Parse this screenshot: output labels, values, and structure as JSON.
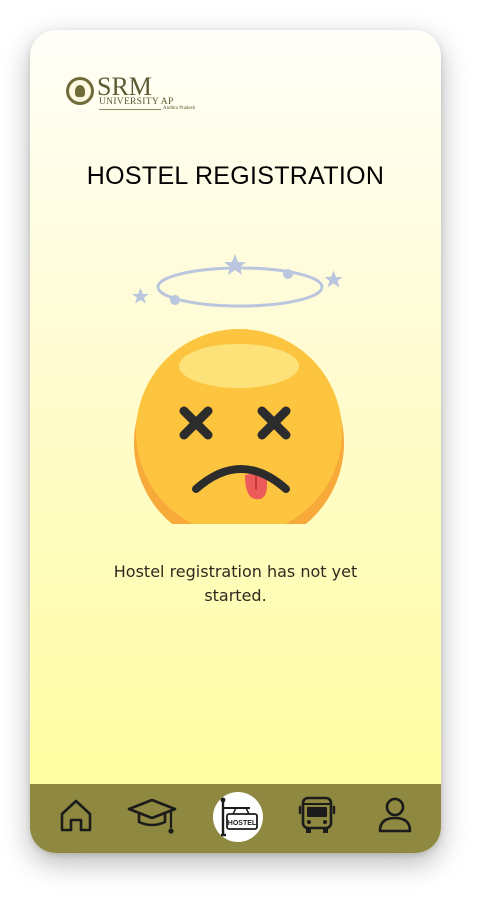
{
  "logo": {
    "name": "SRM",
    "subtitle": "UNIVERSITY AP",
    "state": "Andhra Pradesh"
  },
  "page": {
    "title": "HOSTEL REGISTRATION",
    "message": "Hostel registration has not yet started."
  },
  "nav": {
    "items": [
      {
        "id": "home",
        "icon": "home-icon"
      },
      {
        "id": "academics",
        "icon": "graduation-cap-icon"
      },
      {
        "id": "hostel",
        "icon": "hostel-sign-icon",
        "label": "HOSTEL",
        "active": true
      },
      {
        "id": "transport",
        "icon": "bus-icon"
      },
      {
        "id": "profile",
        "icon": "user-icon"
      }
    ]
  },
  "colors": {
    "nav_background": "#8e8840",
    "emoji_face": "#fcc43f",
    "title_text": "#000000"
  }
}
